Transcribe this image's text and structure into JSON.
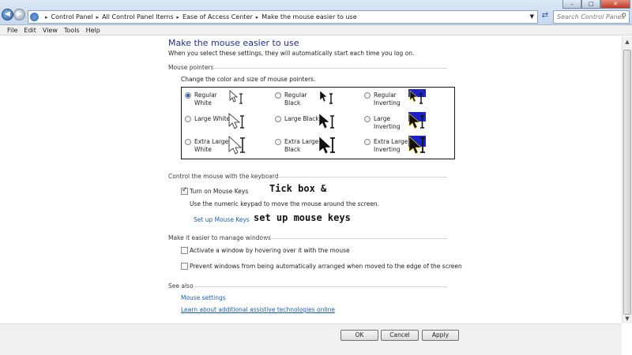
{
  "address": {
    "crumbs": [
      "Control Panel",
      "All Control Panel Items",
      "Ease of Access Center",
      "Make the mouse easier to use"
    ],
    "search_placeholder": "Search Control Panel"
  },
  "menu": [
    "File",
    "Edit",
    "View",
    "Tools",
    "Help"
  ],
  "page": {
    "title": "Make the mouse easier to use",
    "subtitle": "When you select these settings, they will automatically start each time you log on."
  },
  "pointers": {
    "heading": "Mouse pointers",
    "description": "Change the color and size of mouse pointers.",
    "options": [
      {
        "line1": "Regular",
        "line2": "White",
        "selected": true
      },
      {
        "line1": "Regular",
        "line2": "Black",
        "selected": false
      },
      {
        "line1": "Regular",
        "line2": "Inverting",
        "selected": false
      },
      {
        "line1": "Large White",
        "line2": "",
        "selected": false
      },
      {
        "line1": "Large Black",
        "line2": "",
        "selected": false
      },
      {
        "line1": "Large",
        "line2": "Inverting",
        "selected": false
      },
      {
        "line1": "Extra Large",
        "line2": "White",
        "selected": false
      },
      {
        "line1": "Extra Large",
        "line2": "Black",
        "selected": false
      },
      {
        "line1": "Extra Large",
        "line2": "Inverting",
        "selected": false
      }
    ]
  },
  "keyboard": {
    "heading": "Control the mouse with the keyboard",
    "mouse_keys_label": "Turn on Mouse Keys",
    "mouse_keys_checked": true,
    "description": "Use the numeric keypad to move the mouse around the screen.",
    "setup_link": "Set up Mouse Keys"
  },
  "windows": {
    "heading": "Make it easier to manage windows",
    "hover_label": "Activate a window by hovering over it with the mouse",
    "hover_checked": false,
    "snap_label": "Prevent windows from being automatically arranged when moved to the edge of the screen",
    "snap_checked": false
  },
  "see_also": {
    "heading": "See also",
    "mouse_settings": "Mouse settings",
    "assistive": "Learn about additional assistive technologies online"
  },
  "annotations": {
    "tick": "Tick box &",
    "setup": "set up mouse keys"
  },
  "buttons": {
    "ok": "OK",
    "cancel": "Cancel",
    "apply": "Apply"
  },
  "colors": {
    "link": "#1a5fb4",
    "title": "#1e3287",
    "inverting_bg": "#1a22c8"
  }
}
